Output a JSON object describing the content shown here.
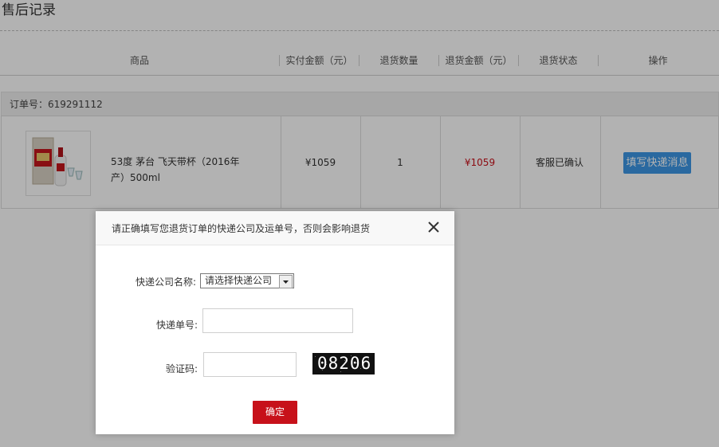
{
  "page": {
    "title": "售后记录"
  },
  "table": {
    "headers": [
      "商品",
      "实付金额（元）",
      "退货数量",
      "退货金额（元）",
      "退货状态",
      "操作"
    ]
  },
  "order": {
    "number_label": "订单号：619291112",
    "product_name": "53度 茅台 飞天带杯（2016年产）500ml",
    "paid_amount": "¥1059",
    "return_qty": "1",
    "return_amount": "¥1059",
    "status": "客服已确认",
    "action_label": "填写快递消息"
  },
  "dialog": {
    "title": "请正确填写您退货订单的快递公司及运单号，否则会影响退货",
    "courier_label": "快递公司名称:",
    "courier_selected": "请选择快递公司",
    "tracking_label": "快递单号:",
    "tracking_value": "",
    "captcha_label": "验证码:",
    "captcha_input_value": "",
    "captcha_text": "08206",
    "confirm_label": "确定"
  },
  "colors": {
    "accent_blue": "#3d97e6",
    "confirm_red": "#c7111a",
    "price_red": "#c9111a"
  }
}
